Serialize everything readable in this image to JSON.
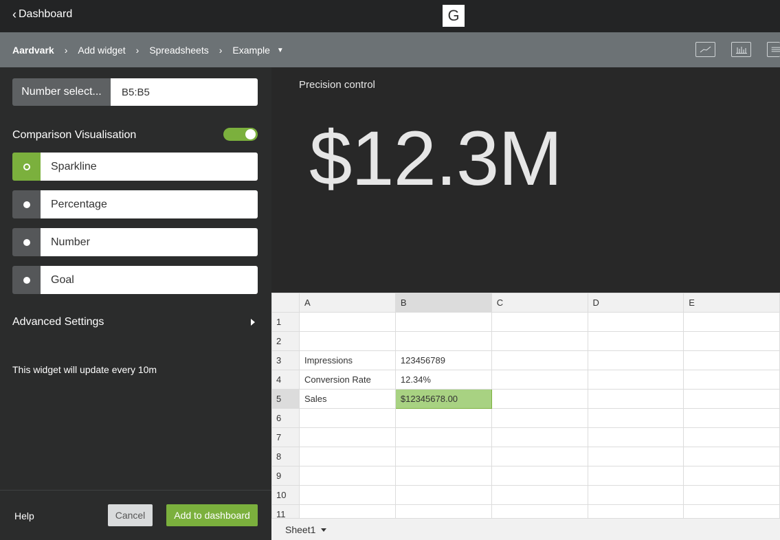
{
  "topbar": {
    "back_label": "Dashboard",
    "logo_letter": "G"
  },
  "breadcrumb": {
    "items": [
      "Aardvark",
      "Add widget",
      "Spreadsheets",
      "Example"
    ],
    "separator": "›"
  },
  "viz_buttons": [
    "line-chart-icon",
    "bar-chart-icon",
    "list-icon"
  ],
  "number_selection": {
    "label": "Number select...",
    "value": "B5:B5"
  },
  "comparison": {
    "label": "Comparison Visualisation",
    "enabled": true,
    "options": [
      "Sparkline",
      "Percentage",
      "Number",
      "Goal"
    ],
    "selected": "Sparkline"
  },
  "advanced_label": "Advanced Settings",
  "update_note": "This widget will update every 10m",
  "footer": {
    "help": "Help",
    "cancel": "Cancel",
    "add": "Add to dashboard"
  },
  "preview": {
    "title": "Precision control",
    "value": "$12.3M"
  },
  "sheet": {
    "columns": [
      "A",
      "B",
      "C",
      "D",
      "E"
    ],
    "rows": [
      "1",
      "2",
      "3",
      "4",
      "5",
      "6",
      "7",
      "8",
      "9",
      "10",
      "11"
    ],
    "cells": {
      "3": [
        "Impressions",
        "123456789"
      ],
      "4": [
        "Conversion Rate",
        "12.34%"
      ],
      "5": [
        "Sales",
        "$12345678.00"
      ]
    },
    "selected_cell": "B5",
    "tab": "Sheet1"
  },
  "colors": {
    "accent": "#7bb03d",
    "topbar": "#232425",
    "crumbbar": "#6c7275",
    "panel": "#2b2c2c"
  }
}
